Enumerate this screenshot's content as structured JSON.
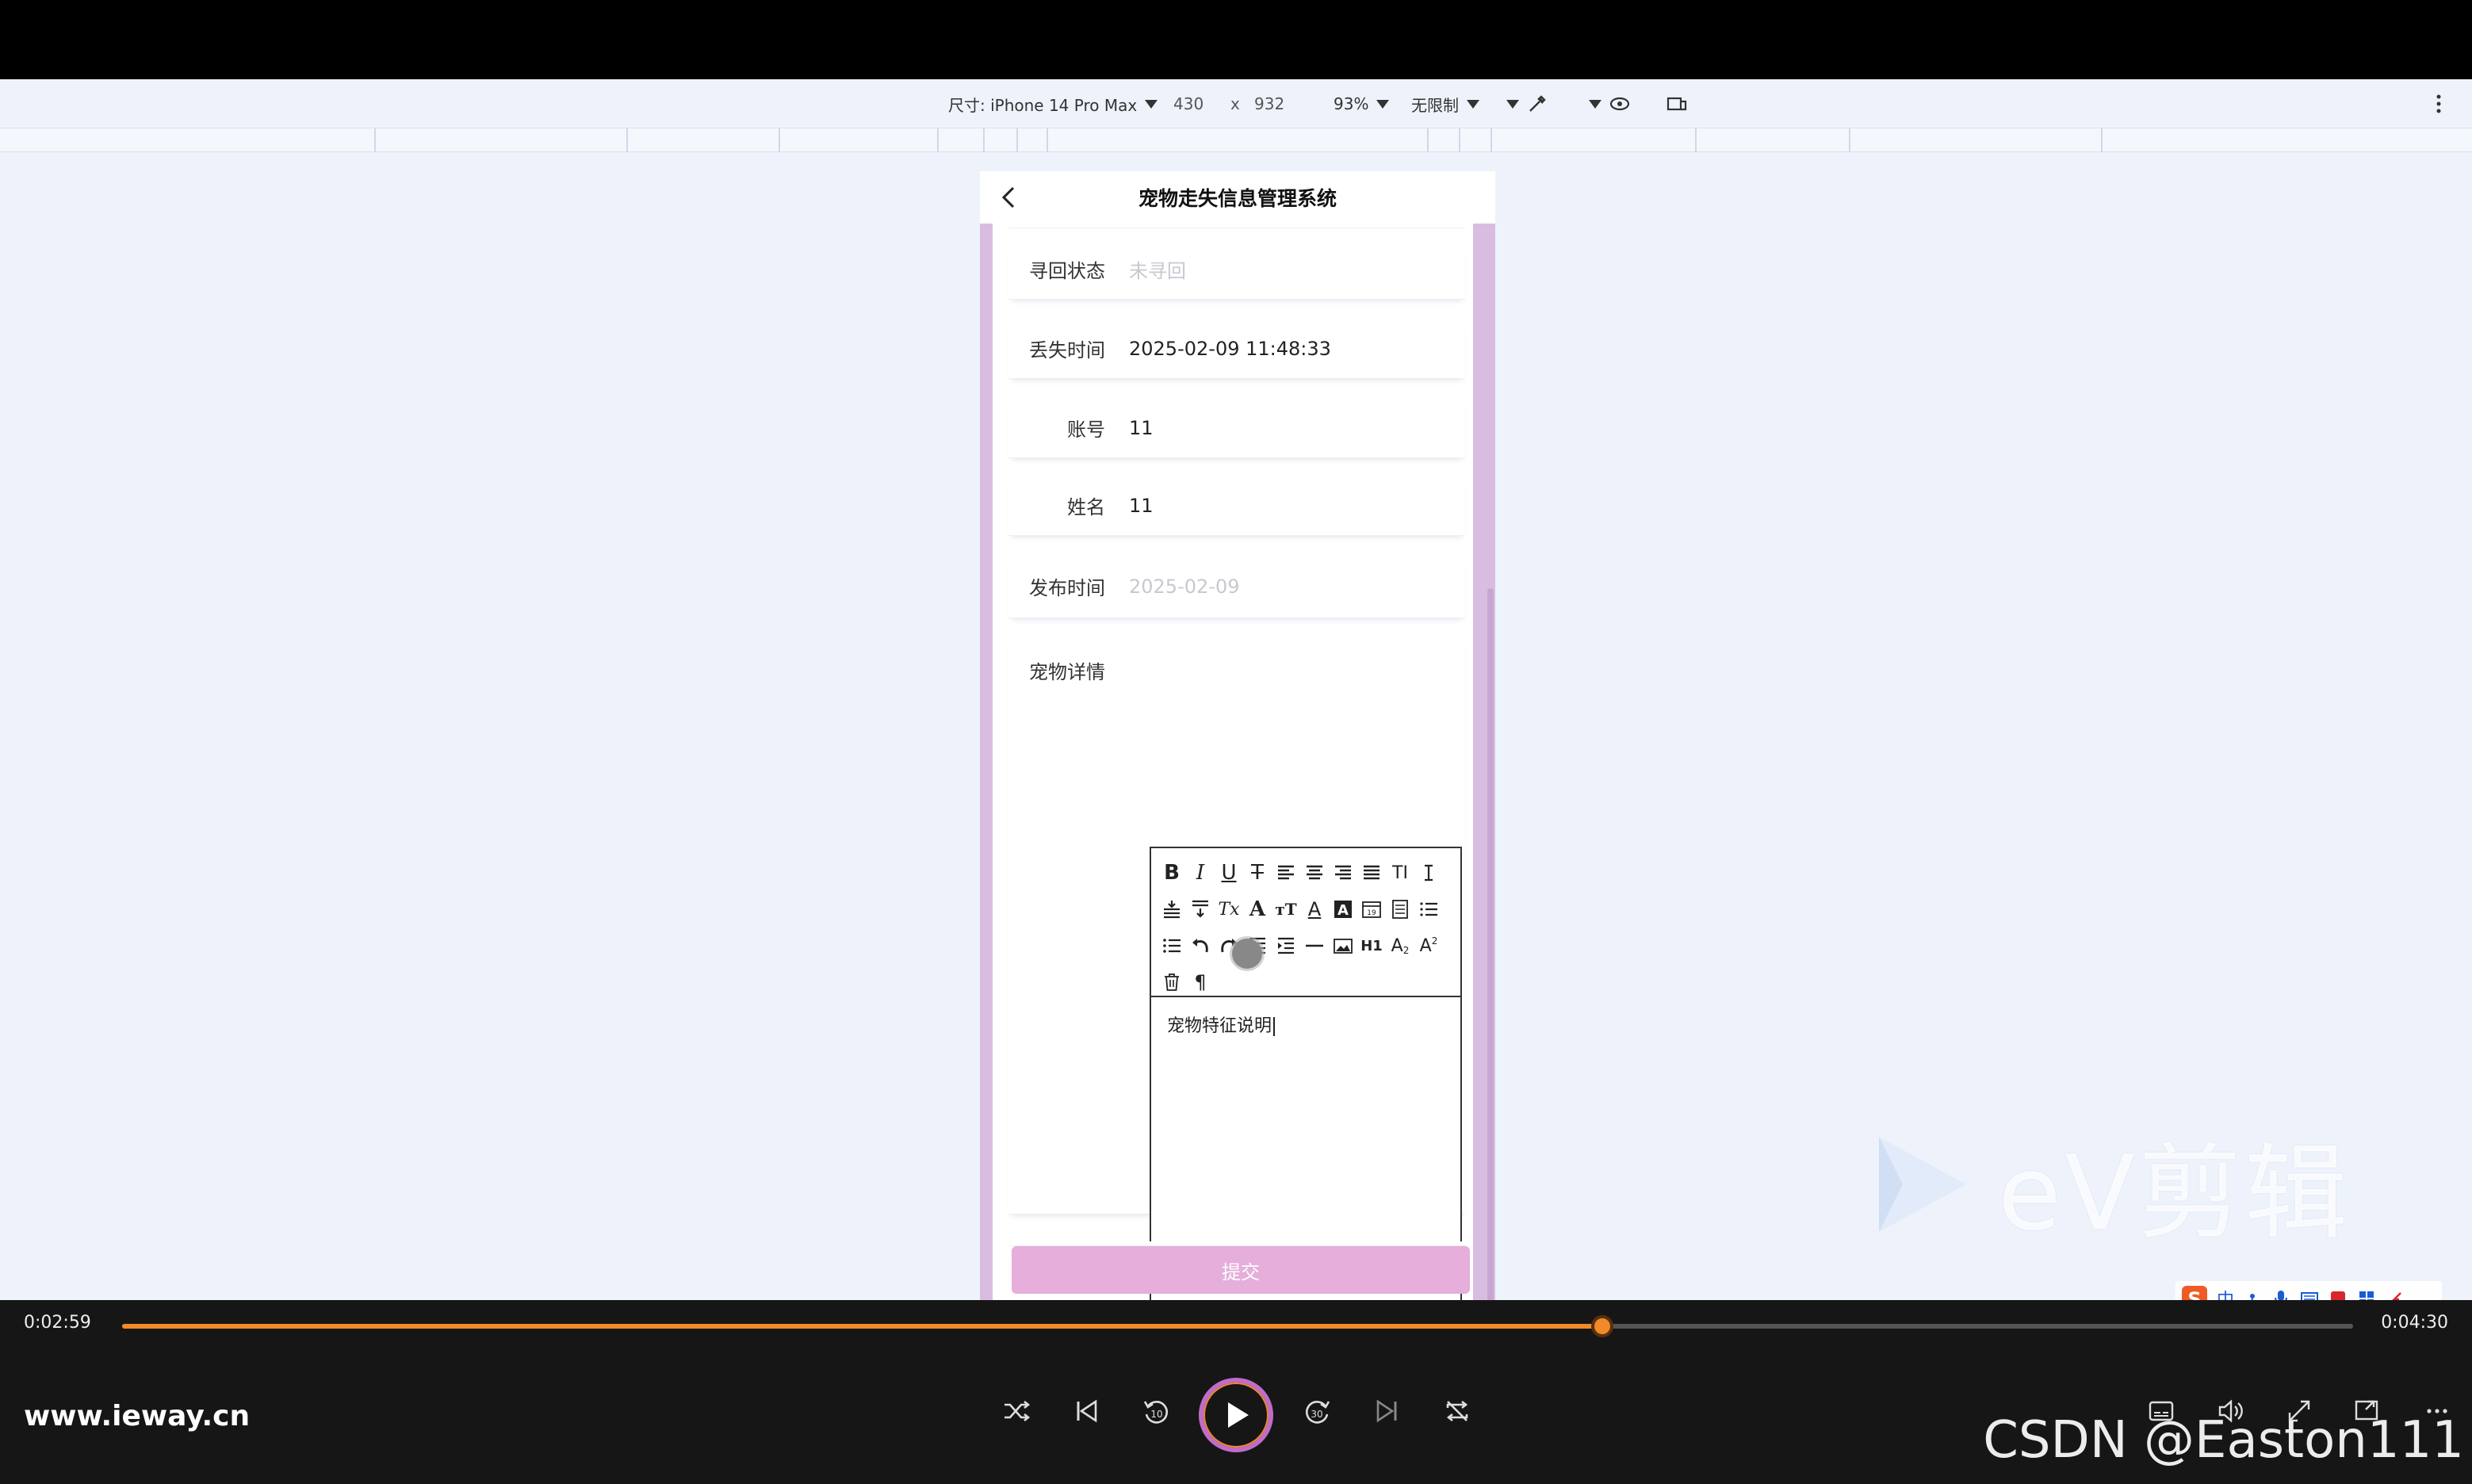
{
  "devtools": {
    "device_label": "尺寸: iPhone 14 Pro Max",
    "width": "430",
    "times": "x",
    "height": "932",
    "zoom": "93%",
    "throttle": "无限制"
  },
  "app": {
    "title": "宠物走失信息管理系统",
    "fields": [
      {
        "label": "寻回状态",
        "value": "未寻回",
        "placeholder": true
      },
      {
        "label": "丢失时间",
        "value": "2025-02-09 11:48:33",
        "placeholder": false
      },
      {
        "label": "账号",
        "value": "11",
        "placeholder": false
      },
      {
        "label": "姓名",
        "value": "11",
        "placeholder": false
      },
      {
        "label": "发布时间",
        "value": "2025-02-09",
        "placeholder": true
      }
    ],
    "details_label": "宠物详情",
    "editor_content": "宠物特征说明",
    "submit_label": "提交"
  },
  "watermark": {
    "text": "eV剪辑"
  },
  "ime": {
    "glyph": "中"
  },
  "player": {
    "current_time": "0:02:59",
    "total_time": "0:04:30",
    "progress": 0.6633,
    "site": "www.ieway.cn",
    "brand": "CSDN @Easton111"
  }
}
